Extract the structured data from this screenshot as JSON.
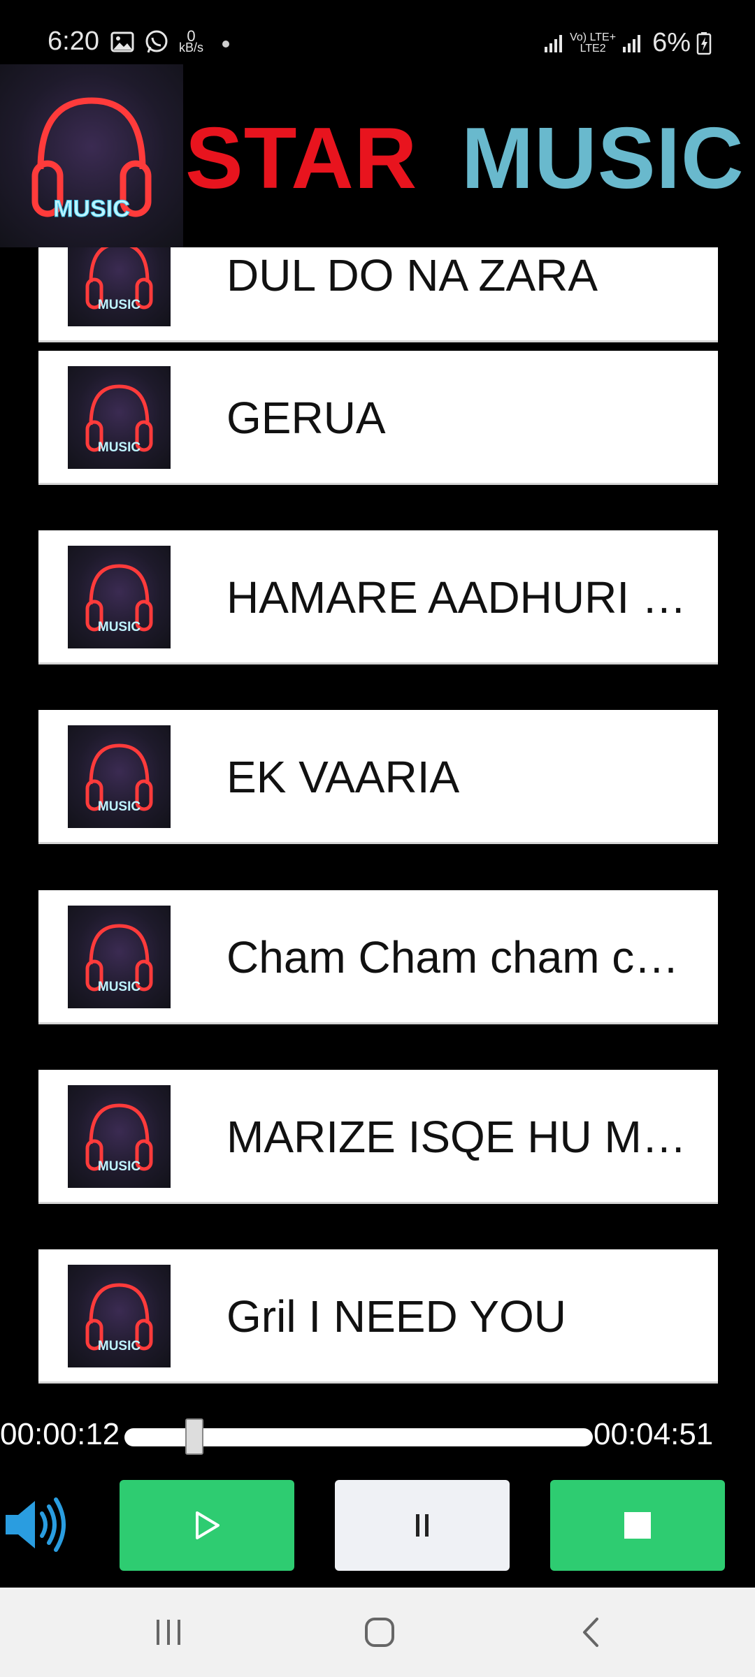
{
  "status_bar": {
    "time": "6:20",
    "speed_value": "0",
    "speed_unit": "kB/s",
    "network_label_top": "Vo) LTE+",
    "network_label_bottom": "LTE2",
    "battery": "6%",
    "icons": [
      "gallery-icon",
      "whatsapp-icon",
      "signal-icon",
      "battery-charging-icon"
    ]
  },
  "header": {
    "logo_text": "MUSIC",
    "title_part1": "STAR",
    "title_part2": "MUSIC",
    "colors": {
      "title_part1": "#e8141e",
      "title_part2": "#69b9cd"
    }
  },
  "songs": [
    {
      "title": "DUL DO NA ZARA",
      "thumb_text": "MUSIC"
    },
    {
      "title": "GERUA",
      "thumb_text": "MUSIC"
    },
    {
      "title": "HAMARE AADHURI KAHANI",
      "thumb_text": "MUSIC"
    },
    {
      "title": "EK VAARIA",
      "thumb_text": "MUSIC"
    },
    {
      "title": "Cham Cham cham cham",
      "thumb_text": "MUSIC"
    },
    {
      "title": "MARIZE ISQE HU MAIN",
      "thumb_text": "MUSIC"
    },
    {
      "title": "Gril I NEED YOU",
      "thumb_text": "MUSIC"
    }
  ],
  "player": {
    "current_time": "00:00:12",
    "total_time": "00:04:51",
    "progress_fraction": 0.041,
    "accent_color": "#2ecc71"
  },
  "nav": {
    "icons": [
      "recents-icon",
      "home-icon",
      "back-icon"
    ]
  }
}
